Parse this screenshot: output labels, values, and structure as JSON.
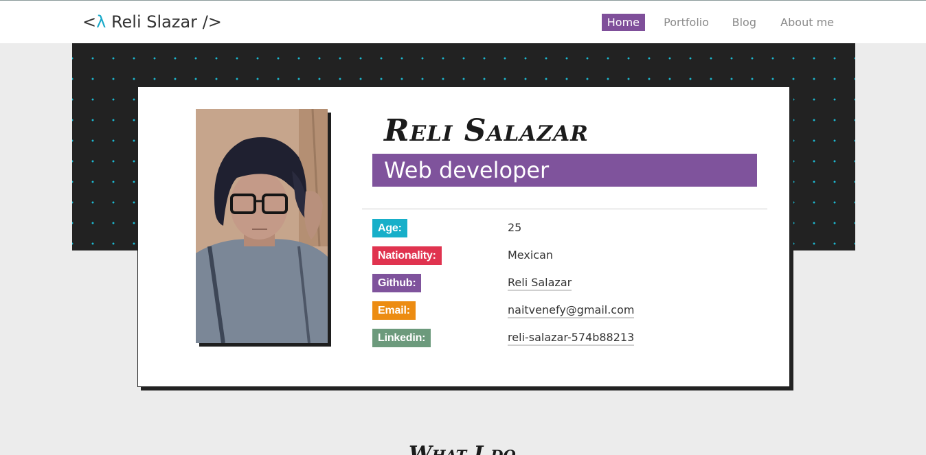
{
  "brand": {
    "prefix": "<",
    "lambda": "λ",
    "name": " Reli Slazar ",
    "suffix": "/>"
  },
  "nav": {
    "items": [
      {
        "label": "Home",
        "active": true
      },
      {
        "label": "Portfolio",
        "active": false
      },
      {
        "label": "Blog",
        "active": false
      },
      {
        "label": "About me",
        "active": false
      }
    ]
  },
  "profile": {
    "name": "Reli Salazar",
    "title": "Web developer",
    "info": [
      {
        "label": "Age:",
        "value": "25",
        "color": "#17afc9",
        "link": false
      },
      {
        "label": "Nationality:",
        "value": "Mexican",
        "color": "#e0334f",
        "link": false
      },
      {
        "label": "Github:",
        "value": "Reli Salazar",
        "color": "#7f539c",
        "link": true
      },
      {
        "label": "Email:",
        "value": "naitvenefy@gmail.com",
        "color": "#ec8c12",
        "link": true
      },
      {
        "label": "Linkedin:",
        "value": "reli-salazar-574b88213",
        "color": "#6c9a7c",
        "link": true
      }
    ]
  },
  "next_section": {
    "heading": "What I do"
  },
  "colors": {
    "accent": "#7f539c",
    "pattern_dot": "#1cb8d0",
    "pattern_bg": "#222222",
    "page_bg": "#ececec"
  }
}
